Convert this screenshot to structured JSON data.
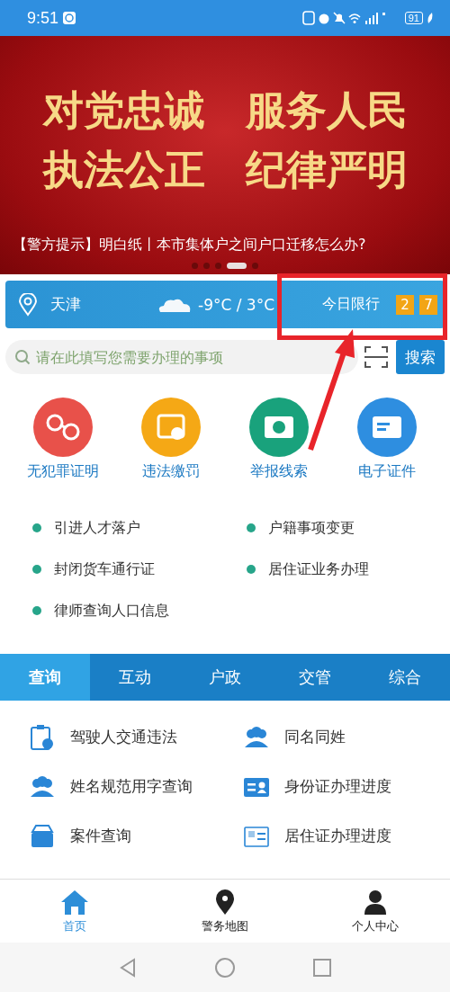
{
  "status_bar": {
    "time": "9:51",
    "battery": "91"
  },
  "banner": {
    "lines": [
      "对党忠诚　服务人民",
      "执法公正　纪律严明"
    ],
    "caption": "【警方提示】明白纸丨本市集体户之间户口迁移怎么办?",
    "dots": [
      {
        "selected": false
      },
      {
        "selected": false
      },
      {
        "selected": false
      },
      {
        "selected": true
      },
      {
        "selected": false
      }
    ]
  },
  "weather": {
    "city": "天津",
    "temperature": "-9°C / 3°C",
    "restriction_label": "今日限行",
    "restriction_numbers": [
      "2",
      "7"
    ]
  },
  "search": {
    "placeholder": "请在此填写您需要办理的事项",
    "button": "搜索"
  },
  "services": [
    {
      "label": "无犯罪证明",
      "color": "#e8514a",
      "kind": "handcuffs"
    },
    {
      "label": "违法缴罚",
      "color": "#f5a815",
      "kind": "payment"
    },
    {
      "label": "举报线索",
      "color": "#19a27c",
      "kind": "camera"
    },
    {
      "label": "电子证件",
      "color": "#2e8ee0",
      "kind": "card"
    }
  ],
  "quick_links": [
    "引进人才落户",
    "户籍事项变更",
    "封闭货车通行证",
    "居住证业务办理",
    "律师查询人口信息"
  ],
  "tabs": [
    {
      "label": "查询",
      "selected": true
    },
    {
      "label": "互动",
      "selected": false
    },
    {
      "label": "户政",
      "selected": false
    },
    {
      "label": "交管",
      "selected": false
    },
    {
      "label": "综合",
      "selected": false
    }
  ],
  "list": [
    {
      "label": "驾驶人交通违法",
      "kind": "clipboard"
    },
    {
      "label": "同名同姓",
      "kind": "people"
    },
    {
      "label": "姓名规范用字查询",
      "kind": "people"
    },
    {
      "label": "身份证办理进度",
      "kind": "idcard"
    },
    {
      "label": "案件查询",
      "kind": "inbox"
    },
    {
      "label": "居住证办理进度",
      "kind": "residence"
    }
  ],
  "bottom_nav": [
    {
      "label": "首页",
      "selected": true,
      "kind": "home"
    },
    {
      "label": "警务地图",
      "selected": false,
      "kind": "pin"
    },
    {
      "label": "个人中心",
      "selected": false,
      "kind": "person"
    }
  ]
}
